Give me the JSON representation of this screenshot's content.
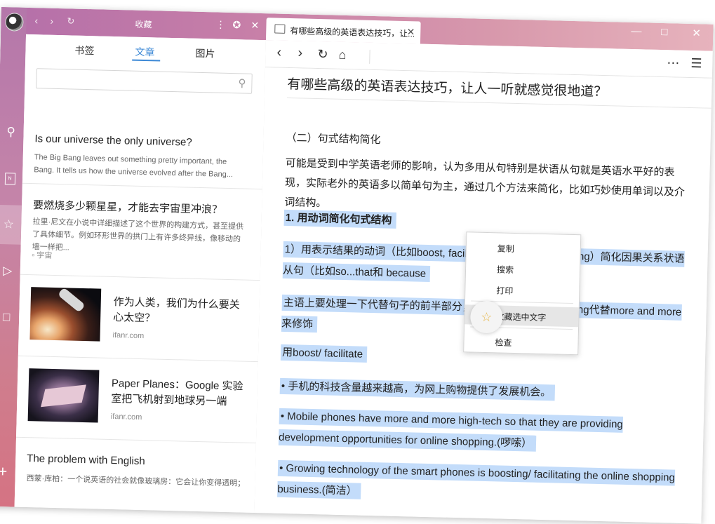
{
  "sidebar": {
    "title": "收藏",
    "tabs": [
      "书签",
      "文章",
      "图片"
    ],
    "active_tab": "文章",
    "search_placeholder": "",
    "items": [
      {
        "title": "Is our universe the only universe?",
        "desc": "The Big Bang leaves out something pretty important, the Bang. It tells us how the universe evolved after the Bang..."
      },
      {
        "title": "要燃烧多少颗星星，才能去宇宙里冲浪？",
        "desc": "拉里·尼文在小说中详细描述了这个世界的构建方式，甚至提供了具体细节。例如环形世界的拱门上有许多终异线，像移动的墙一样把...",
        "tag": "宇宙"
      },
      {
        "title": "作为人类，我们为什么要关心太空？",
        "source": "ifanr.com",
        "image": "rocket-launch-image"
      },
      {
        "title": "Paper Planes：Google 实验室把飞机射到地球另一端",
        "source": "ifanr.com",
        "image": "paper-plane-image"
      },
      {
        "title": "The problem with English",
        "desc": "西蒙·库柏：一个说英语的社会就像玻璃房：它会让你变得透明；对"
      }
    ]
  },
  "browser": {
    "tab_title": "有哪些高级的英语表达技巧，让...",
    "window_controls": [
      "minimize",
      "maximize",
      "close"
    ]
  },
  "article": {
    "title": "有哪些高级的英语表达技巧，让人一听就感觉很地道？",
    "section": "（二）句式结构简化",
    "intro": "可能是受到中学英语老师的影响，认为多用从句特别是状语从句就是英语水平好的表现，实际老外的英语多以简单句为主，通过几个方法来简化，比如巧妙使用单词以及介词结构。",
    "heading": "1. 用动词简化句式结构",
    "p1": "1）用表示结果的动词（比如boost, facilitate, …… ……duce, bring）简化因果关系状语从句（比如so...that和 because",
    "p2": "主语上要处理一下代替句子的前半部分，用 ……rowing/increasing代替more and more来修饰",
    "p3": "用boost/ facilitate",
    "p4": "• 手机的科技含量越来越高，为网上购物提供了发展机会。",
    "p5": "• Mobile phones have more and more high-tech so that  they are providing development opportunities for online shopping.(啰嗦）",
    "p6": "• Growing technology of the smart phones is boosting/ facilitating the online shopping business.(简洁）"
  },
  "context_menu": {
    "items": [
      "复制",
      "搜索",
      "打印",
      "收藏选中文字",
      "检查"
    ],
    "highlighted": "收藏选中文字"
  }
}
